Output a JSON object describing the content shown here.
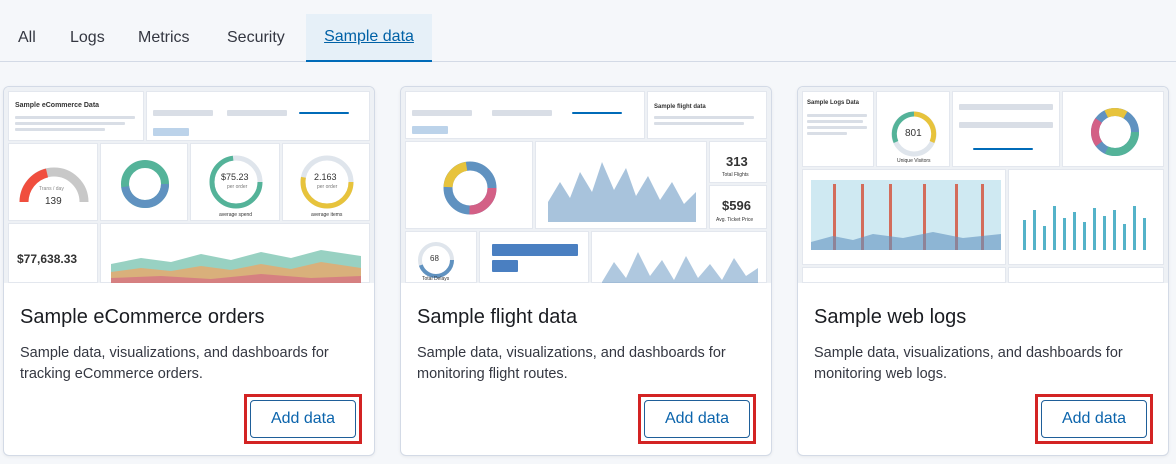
{
  "tabs": [
    {
      "label": "All"
    },
    {
      "label": "Logs"
    },
    {
      "label": "Metrics"
    },
    {
      "label": "Security"
    },
    {
      "label": "Sample data"
    }
  ],
  "cards": [
    {
      "title": "Sample eCommerce orders",
      "description": "Sample data, visualizations, and dashboards for tracking eCommerce orders.",
      "button_label": "Add data",
      "thumb": {
        "heading": "Sample eCommerce Data",
        "trans_label": "Trans / day",
        "trans_value": "139",
        "price_value": "$75.23",
        "price_sub": "per order",
        "price_caption": "average spend",
        "qty_value": "2.163",
        "qty_sub": "per order",
        "qty_caption": "average items",
        "revenue_value": "$77,638.33"
      }
    },
    {
      "title": "Sample flight data",
      "description": "Sample data, visualizations, and dashboards for monitoring flight routes.",
      "button_label": "Add data",
      "thumb": {
        "heading": "Sample flight data",
        "flights_value": "313",
        "flights_caption": "Total Flights",
        "price_value": "$596",
        "price_caption": "Avg. Ticket Price",
        "delays_value": "68",
        "delays_caption": "Total Delays"
      }
    },
    {
      "title": "Sample web logs",
      "description": "Sample data, visualizations, and dashboards for monitoring web logs.",
      "button_label": "Add data",
      "thumb": {
        "heading": "Sample Logs Data",
        "visitors_value": "801",
        "visitors_caption": "Unique Visitors"
      }
    }
  ],
  "colors": {
    "accent": "#006bb8",
    "highlight_border": "#d32323",
    "button_text": "#0b64ac"
  }
}
